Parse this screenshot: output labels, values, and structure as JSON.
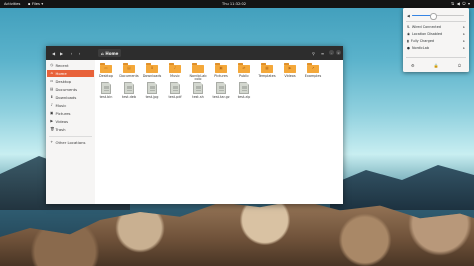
{
  "topbar": {
    "activities": "Activities",
    "app_menu": "Files",
    "clock": "Thu 11:32:02",
    "tray_icons": [
      "network-icon",
      "volume-icon",
      "power-icon",
      "chevron-down-icon"
    ]
  },
  "window": {
    "path_label": "Home",
    "sidebar": [
      {
        "label": "Recent",
        "icon": "clock-icon",
        "active": false
      },
      {
        "label": "Home",
        "icon": "home-icon",
        "active": true
      },
      {
        "label": "Desktop",
        "icon": "desktop-icon",
        "active": false
      },
      {
        "label": "Documents",
        "icon": "document-icon",
        "active": false
      },
      {
        "label": "Downloads",
        "icon": "download-icon",
        "active": false
      },
      {
        "label": "Music",
        "icon": "music-icon",
        "active": false
      },
      {
        "label": "Pictures",
        "icon": "picture-icon",
        "active": false
      },
      {
        "label": "Videos",
        "icon": "video-icon",
        "active": false
      },
      {
        "label": "Trash",
        "icon": "trash-icon",
        "active": false
      },
      {
        "label": "Other Locations",
        "icon": "plus-icon",
        "active": false
      }
    ],
    "folders": [
      {
        "label": "Desktop",
        "icon": "desktop-icon"
      },
      {
        "label": "Documents",
        "icon": "document-icon"
      },
      {
        "label": "Downloads",
        "icon": "download-icon"
      },
      {
        "label": "Music",
        "icon": "music-icon"
      },
      {
        "label": "NordicLab\ncolo",
        "icon": "folder-icon"
      },
      {
        "label": "Pictures",
        "icon": "picture-icon"
      },
      {
        "label": "Public",
        "icon": "share-icon"
      },
      {
        "label": "Templates",
        "icon": "template-icon"
      },
      {
        "label": "Videos",
        "icon": "video-icon"
      },
      {
        "label": "Examples",
        "icon": "link-icon"
      }
    ],
    "files": [
      {
        "label": "test.bin"
      },
      {
        "label": "test.deb"
      },
      {
        "label": "test.jpg"
      },
      {
        "label": "test.pdf"
      },
      {
        "label": "test.sh"
      },
      {
        "label": "test.tar.gz"
      },
      {
        "label": "test.zip"
      }
    ]
  },
  "system_menu": {
    "volume_level": 0.4,
    "rows": [
      {
        "label": "Wired Connected",
        "icon": "wired-icon"
      },
      {
        "label": "Location Disabled",
        "icon": "location-icon"
      },
      {
        "label": "Fully Charged",
        "icon": "battery-icon"
      },
      {
        "label": "NordicLab",
        "icon": "user-icon"
      }
    ],
    "actions": [
      "settings-icon",
      "lock-icon",
      "power-icon"
    ]
  },
  "colors": {
    "accent": "#e8623a",
    "folder": "#f4a83a",
    "headerbar": "#2d2d2d",
    "topbar": "#141414"
  }
}
